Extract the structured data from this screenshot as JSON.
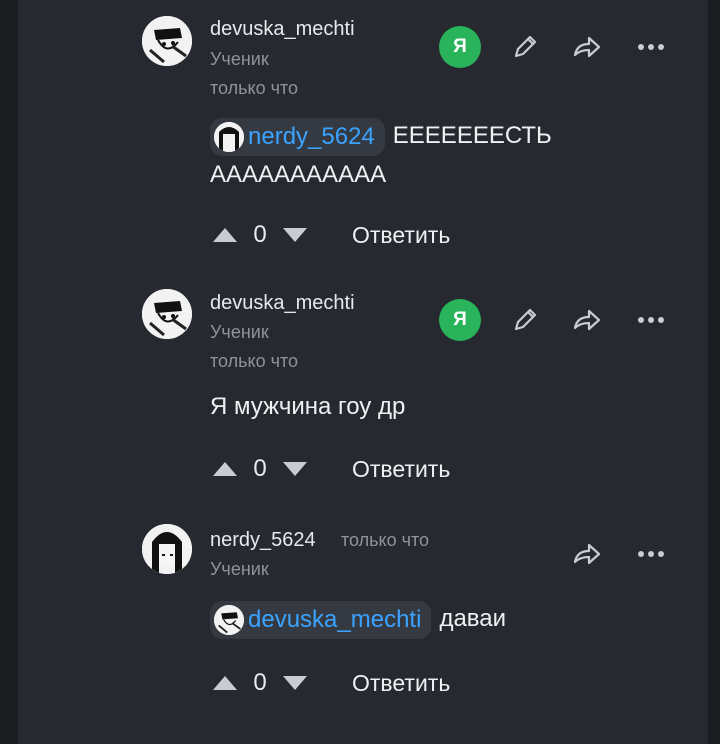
{
  "comments": [
    {
      "author": "devuska_mechti",
      "rank": "Ученик",
      "time": "только что",
      "mention": "nerdy_5624",
      "text_line1": "ЕЕЕЕЕЕЕСТЬ",
      "text_line2": "ААААААААААА",
      "votes": "0",
      "reply_label": "Ответить",
      "badge": "Я"
    },
    {
      "author": "devuska_mechti",
      "rank": "Ученик",
      "time": "только что",
      "text": "Я мужчина гоу др",
      "votes": "0",
      "reply_label": "Ответить",
      "badge": "Я"
    },
    {
      "author": "nerdy_5624",
      "rank": "Ученик",
      "time": "только что",
      "mention": "devuska_mechti",
      "text": "даваи",
      "votes": "0",
      "reply_label": "Ответить"
    }
  ],
  "icons": {
    "edit": "pencil-icon",
    "share": "share-arrow-icon",
    "more": "more-dots-icon",
    "upvote": "triangle-up-icon",
    "downvote": "triangle-down-icon"
  },
  "colors": {
    "background": "#262a30",
    "accent_link": "#3aa3ff",
    "badge_green": "#29b45b",
    "muted_text": "#8e939a"
  }
}
